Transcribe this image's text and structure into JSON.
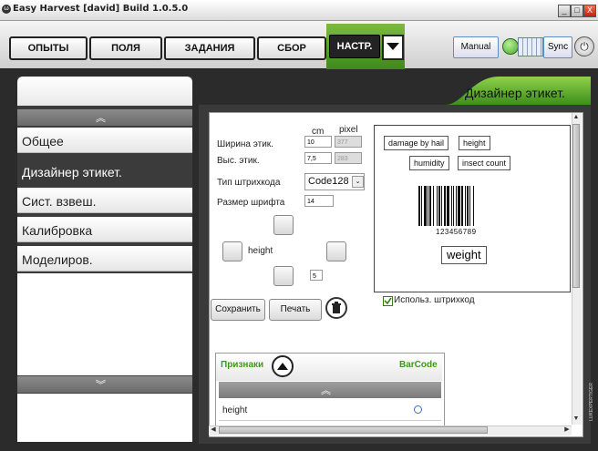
{
  "window": {
    "title": "Easy Harvest [david] Build 1.0.5.0",
    "controls": [
      "_",
      "□",
      "X"
    ]
  },
  "toolbar": {
    "tabs": [
      "ОПЫТЫ",
      "ПОЛЯ",
      "ЗАДАНИЯ",
      "СБОР",
      "НАСТР."
    ],
    "manual_label": "Manual",
    "sync_label": "Sync",
    "power_glyph": "⏻"
  },
  "sidebar": {
    "items": [
      "Общее",
      "Дизайнер этикет.",
      "Сист. взвеш.",
      "Калибровка",
      "Моделиров."
    ],
    "up_chevron": "︽",
    "down_chevron": "︾"
  },
  "header": {
    "title": "Дизайнер этикет."
  },
  "form": {
    "col_cm": "cm",
    "col_pixel": "pixel",
    "width_label": "Ширина этик.",
    "width_cm": "10",
    "width_px": "377",
    "height_label": "Выс. этик.",
    "height_cm": "7,5",
    "height_px": "283",
    "barcode_type_label": "Тип штрихкода",
    "barcode_type_value": "Code128",
    "font_size_label": "Размер шрифта",
    "font_size_value": "14",
    "position_label": "height",
    "step_value": "5",
    "save_label": "Сохранить",
    "print_label": "Печать"
  },
  "preview": {
    "tags": [
      "damage by hail",
      "height",
      "humidity",
      "insect count"
    ],
    "barcode_number": "123456789",
    "weight_label": "weight",
    "use_barcode_label": "Использ. штрихкод",
    "use_barcode_checked": true
  },
  "features": {
    "title": "Признаки",
    "barcode_col": "BarCode",
    "rows": [
      {
        "name": "height",
        "selected": false
      }
    ]
  },
  "side_text": "LUKEXPERTIGER",
  "colors": {
    "green": "#5aa82c",
    "dark": "#2b2b2b",
    "accent_blue": "#5c8fc7"
  }
}
